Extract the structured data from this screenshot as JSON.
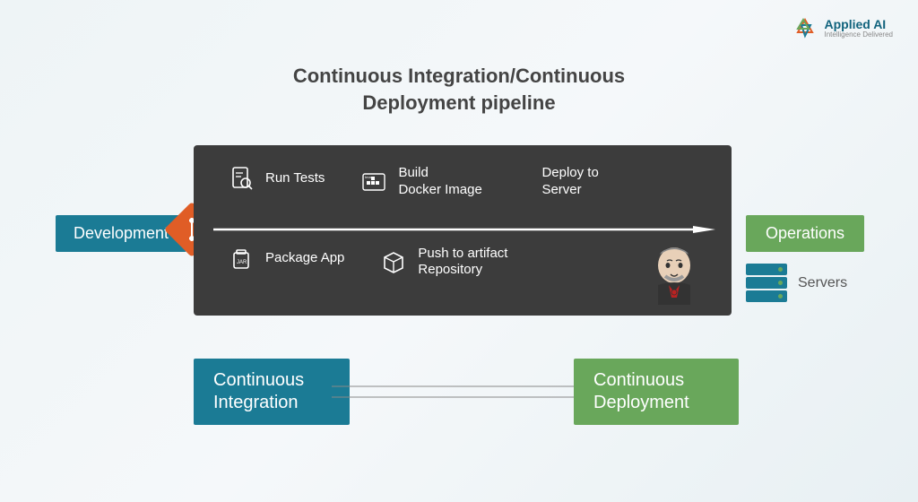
{
  "brand": {
    "title": "Applied AI",
    "subtitle": "Intelligence Delivered"
  },
  "title": "Continuous Integration/Continuous Deployment pipeline",
  "labels": {
    "development": "Development",
    "operations": "Operations",
    "servers": "Servers",
    "ci": "Continuous Integration",
    "cd": "Continuous Deployment"
  },
  "steps": {
    "run_tests": "Run Tests",
    "build_docker": "Build Docker Image",
    "deploy_server": "Deploy to Server",
    "package_app": "Package App",
    "push_artifact": "Push to artifact Repository"
  },
  "icons": {
    "tests": "test-document-icon",
    "docker": "docker-icon",
    "jar": "jar-icon",
    "artifact": "package-icon",
    "jenkins": "jenkins-icon",
    "git": "git-icon",
    "servers": "server-stack-icon"
  },
  "colors": {
    "teal": "#1b7b95",
    "green": "#69a75b",
    "orange": "#e05d26",
    "dark": "#3c3c3c"
  }
}
